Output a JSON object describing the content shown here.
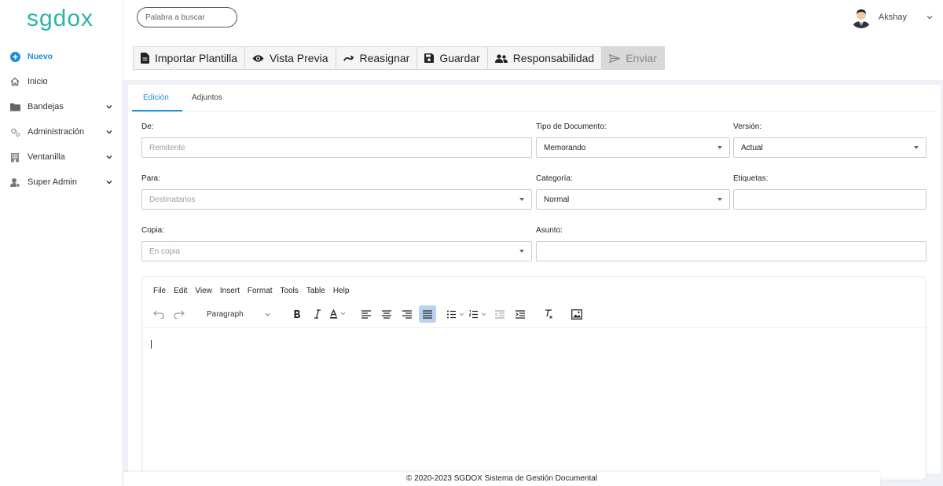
{
  "brand": {
    "logo_text": "sgdox",
    "color": "#2bb5a5"
  },
  "search": {
    "placeholder": "Palabra a buscar"
  },
  "user": {
    "name": "Akshay"
  },
  "sidebar": {
    "items": [
      {
        "label": "Nuevo",
        "icon": "plus-circle-icon"
      },
      {
        "label": "Inicio",
        "icon": "home-icon"
      },
      {
        "label": "Bandejas",
        "icon": "folder-icon"
      },
      {
        "label": "Administración",
        "icon": "gears-icon"
      },
      {
        "label": "Ventanilla",
        "icon": "building-icon"
      },
      {
        "label": "Super Admin",
        "icon": "user-gear-icon"
      }
    ]
  },
  "toolbar": {
    "import": "Importar Plantilla",
    "preview": "Vista Previa",
    "reassign": "Reasignar",
    "save": "Guardar",
    "responsibility": "Responsabilidad",
    "send": "Enviar"
  },
  "tabs": {
    "edit": "Edición",
    "attachments": "Adjuntos"
  },
  "form": {
    "de": {
      "label": "De:",
      "placeholder": "Remitente"
    },
    "tipo": {
      "label": "Tipo de Documento:",
      "value": "Memorando"
    },
    "version": {
      "label": "Versión:",
      "value": "Actual"
    },
    "para": {
      "label": "Para:",
      "placeholder": "Destinatarios"
    },
    "categoria": {
      "label": "Categoría:",
      "value": "Normal"
    },
    "etiquetas": {
      "label": "Etiquetas:"
    },
    "copia": {
      "label": "Copia:",
      "placeholder": "En copia"
    },
    "asunto": {
      "label": "Asunto:"
    }
  },
  "editor": {
    "menu": [
      "File",
      "Edit",
      "View",
      "Insert",
      "Format",
      "Tools",
      "Table",
      "Help"
    ],
    "block_format": "Paragraph"
  },
  "footer": {
    "text": "© 2020-2023 SGDOX Sistema de Gestión Documental"
  },
  "colors": {
    "accent": "#1a8fd6",
    "active_tool": "#b6d4f2"
  }
}
